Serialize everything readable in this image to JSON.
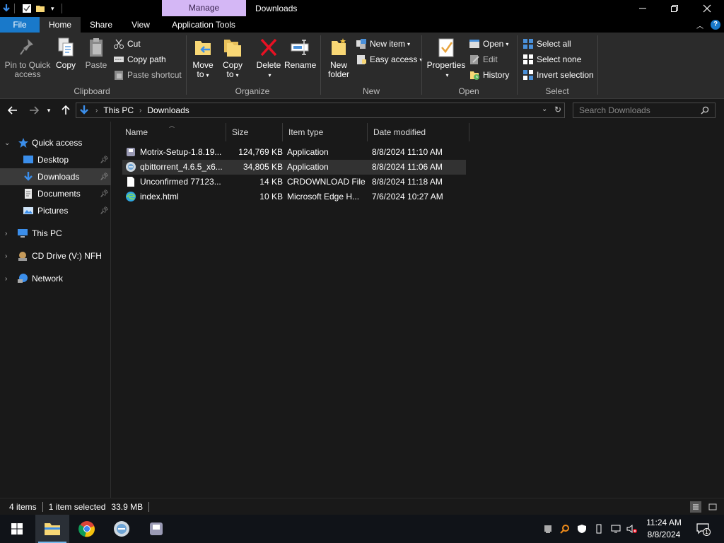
{
  "window": {
    "title": "Downloads",
    "contextual_tab": "Manage",
    "controls": {
      "minimize": "minimize-icon",
      "restore": "restore-icon",
      "close": "close-icon"
    }
  },
  "ribbon_tabs": [
    "File",
    "Home",
    "Share",
    "View",
    "Application Tools"
  ],
  "ribbon": {
    "clipboard": {
      "label": "Clipboard",
      "pin_line1": "Pin to Quick",
      "pin_line2": "access",
      "copy": "Copy",
      "paste": "Paste",
      "cut": "Cut",
      "copy_path": "Copy path",
      "paste_shortcut": "Paste shortcut"
    },
    "organize": {
      "label": "Organize",
      "move_line1": "Move",
      "move_line2": "to",
      "copy_line1": "Copy",
      "copy_line2": "to",
      "delete": "Delete",
      "rename": "Rename"
    },
    "new": {
      "label": "New",
      "new_folder_line1": "New",
      "new_folder_line2": "folder",
      "new_item": "New item",
      "easy_access": "Easy access"
    },
    "open": {
      "label": "Open",
      "properties": "Properties",
      "open": "Open",
      "edit": "Edit",
      "history": "History"
    },
    "select": {
      "label": "Select",
      "select_all": "Select all",
      "select_none": "Select none",
      "invert_selection": "Invert selection"
    }
  },
  "address": {
    "crumbs": [
      "This PC",
      "Downloads"
    ],
    "search_placeholder": "Search Downloads"
  },
  "sidebar": {
    "items": [
      {
        "label": "Quick access",
        "icon": "star-icon"
      },
      {
        "label": "Desktop",
        "icon": "desktop-icon",
        "pinned": true
      },
      {
        "label": "Downloads",
        "icon": "download-icon",
        "pinned": true,
        "selected": true
      },
      {
        "label": "Documents",
        "icon": "documents-icon",
        "pinned": true
      },
      {
        "label": "Pictures",
        "icon": "pictures-icon",
        "pinned": true
      },
      {
        "label": "This PC",
        "icon": "computer-icon"
      },
      {
        "label": "CD Drive (V:) NFH",
        "icon": "cd-drive-icon"
      },
      {
        "label": "Network",
        "icon": "network-icon"
      }
    ]
  },
  "columns": {
    "name": "Name",
    "size": "Size",
    "type": "Item type",
    "date": "Date modified"
  },
  "files": [
    {
      "name": "Motrix-Setup-1.8.19...",
      "size": "124,769 KB",
      "type": "Application",
      "date": "8/8/2024 11:10 AM",
      "icon": "installer-icon"
    },
    {
      "name": "qbittorrent_4.6.5_x6...",
      "size": "34,805 KB",
      "type": "Application",
      "date": "8/8/2024 11:06 AM",
      "icon": "qbittorrent-icon"
    },
    {
      "name": "Unconfirmed 77123...",
      "size": "14 KB",
      "type": "CRDOWNLOAD File",
      "date": "8/8/2024 11:18 AM",
      "icon": "blank-file-icon"
    },
    {
      "name": "index.html",
      "size": "10 KB",
      "type": "Microsoft Edge H...",
      "date": "7/6/2024 10:27 AM",
      "icon": "edge-icon"
    }
  ],
  "status": {
    "item_count": "4 items",
    "selection": "1 item selected",
    "selection_size": "33.9 MB"
  },
  "taskbar": {
    "apps": [
      "file-explorer-icon",
      "chrome-icon",
      "qbittorrent-icon",
      "installer-icon"
    ],
    "time": "11:24 AM",
    "date": "8/8/2024",
    "notification_count": "1"
  },
  "colors": {
    "accent": "#1979ca",
    "manage_tab": "#d4b7f5",
    "background": "#191919",
    "ribbon": "#2b2b2b"
  }
}
